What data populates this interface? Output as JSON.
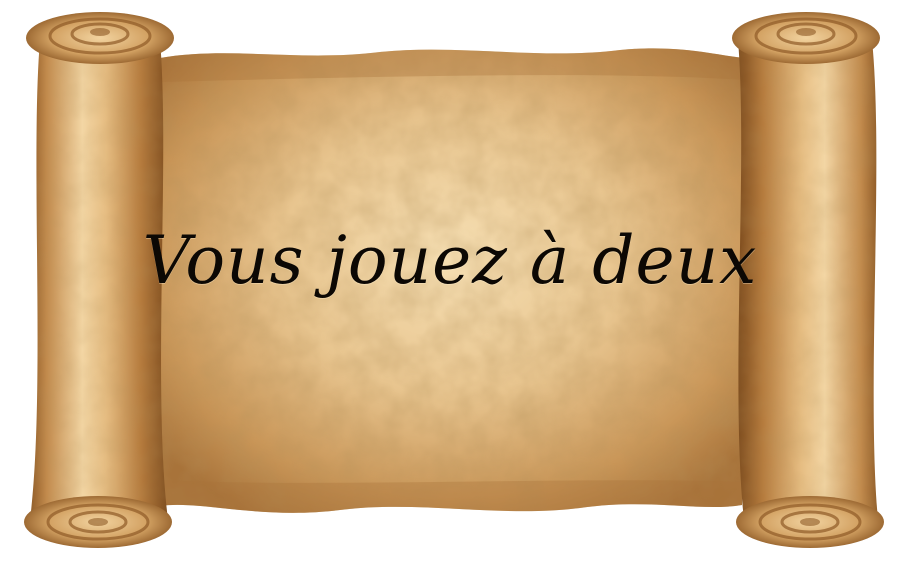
{
  "scroll": {
    "message": "Vous jouez à deux"
  },
  "colors": {
    "parchment_light": "#f3d7a6",
    "parchment_mid": "#d9ad72",
    "parchment_dark": "#a8733a",
    "roll_highlight": "#f6dcae",
    "roll_shadow": "#8e5a26",
    "text": "#0c0804"
  }
}
